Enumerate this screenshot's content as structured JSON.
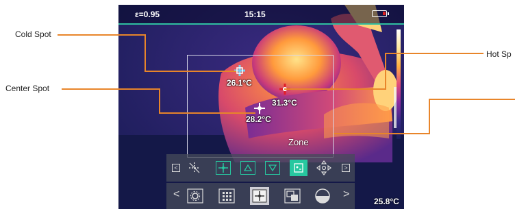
{
  "callouts": {
    "cold_spot": "Cold Spot",
    "center_spot": "Center Spot",
    "hot_spot": "Hot Sp"
  },
  "status": {
    "emissivity": "ε=0.95",
    "time": "15:15"
  },
  "spots": {
    "cold": "26.1°C",
    "hot": "31.3°C",
    "center": "28.2°C"
  },
  "zone_label": "Zone",
  "bottom_temp": "25.8°C",
  "toolbar1": {
    "left_arrow": "<",
    "right_arrow": ">"
  },
  "toolbar2": {
    "left_chevron": "<",
    "right_chevron": ">"
  },
  "colors": {
    "accent": "#27c8a0",
    "leader": "#e8852a",
    "hot_marker": "#e0202a",
    "cold_marker": "#7ad0f0"
  }
}
